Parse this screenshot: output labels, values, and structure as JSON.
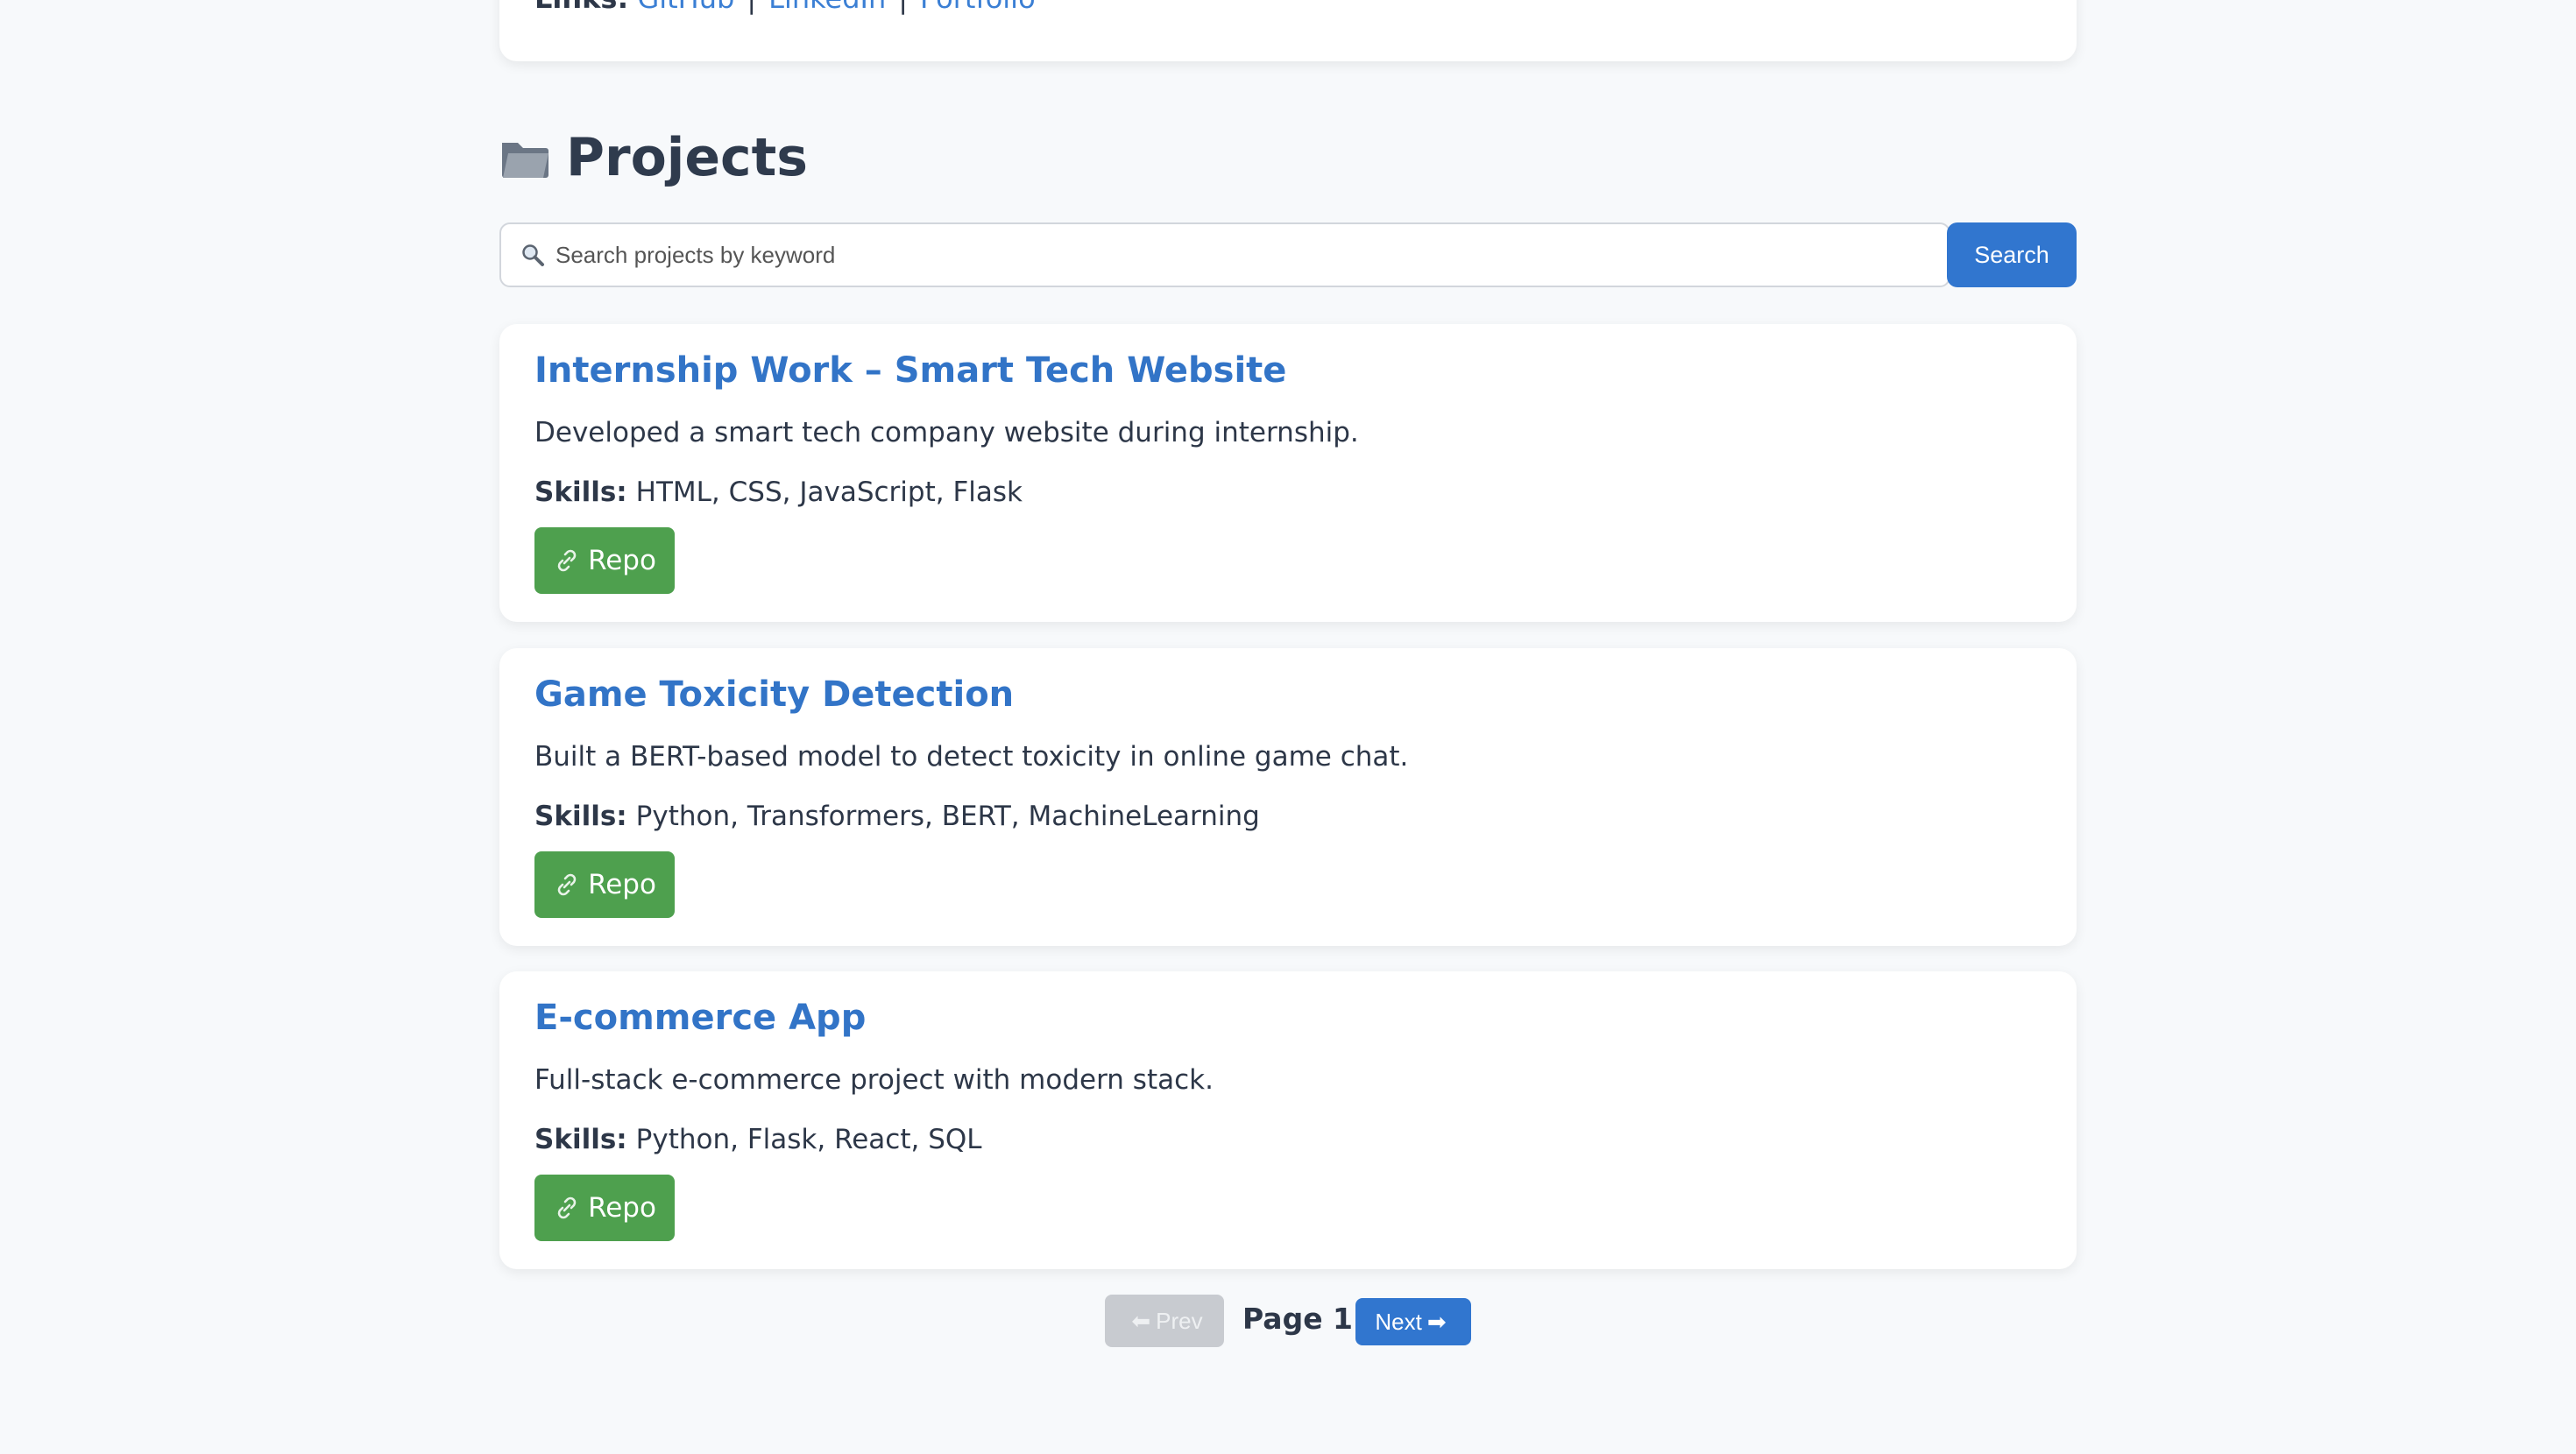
{
  "links": {
    "label": "Links:",
    "items": [
      "GitHub",
      "LinkedIn",
      "Portfolio"
    ],
    "separator": "|"
  },
  "projects": {
    "heading": "Projects",
    "search": {
      "placeholder": "Search projects by keyword",
      "button_label": "Search"
    },
    "skills_label": "Skills:",
    "repo_label": "Repo",
    "items": [
      {
        "title": "Internship Work – Smart Tech Website",
        "description": "Developed a smart tech company website during internship.",
        "skills": "HTML, CSS, JavaScript, Flask"
      },
      {
        "title": "Game Toxicity Detection",
        "description": "Built a BERT-based model to detect toxicity in online game chat.",
        "skills": "Python, Transformers, BERT, MachineLearning"
      },
      {
        "title": "E-commerce App",
        "description": "Full-stack e-commerce project with modern stack.",
        "skills": "Python, Flask, React, SQL"
      }
    ]
  },
  "pagination": {
    "prev_label": "Prev",
    "page_label": "Page 1",
    "next_label": "Next"
  },
  "colors": {
    "accent": "#3176cf",
    "title_link": "#3274c7",
    "repo_button": "#4ea04e",
    "disabled_button": "#c8cbd0",
    "background": "#f7f9fb"
  },
  "icons": {
    "heading": "folder-icon",
    "search": "magnifier-icon",
    "repo": "link-icon",
    "prev": "arrow-left-icon",
    "next": "arrow-right-icon"
  }
}
